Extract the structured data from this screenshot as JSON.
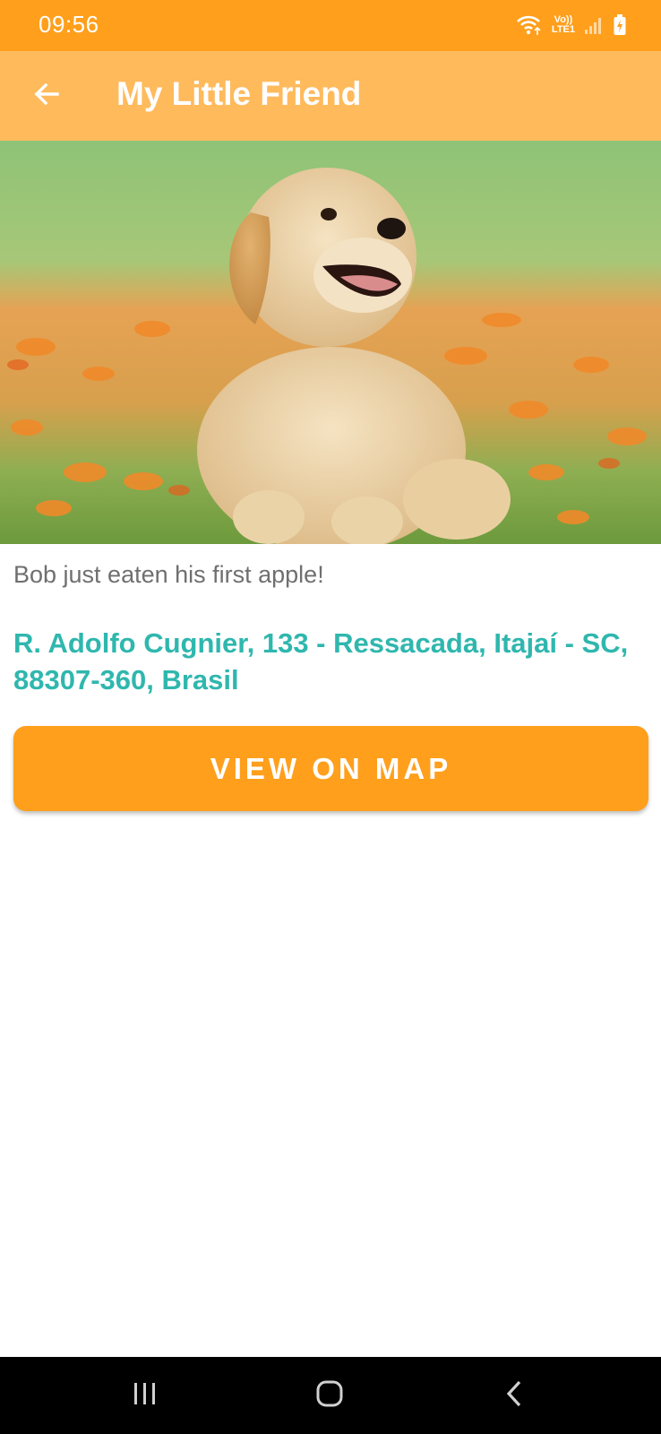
{
  "status_bar": {
    "time": "09:56",
    "network_top": "Vo))",
    "network_bottom": "LTE1",
    "icons": [
      "wifi-icon",
      "signal-icon",
      "battery-charging-icon"
    ]
  },
  "app_bar": {
    "title": "My Little Friend",
    "back_icon": "arrow-left-icon",
    "color": "#FFBA5C"
  },
  "post": {
    "photo": "golden-retriever-puppy-photo",
    "caption": "Bob just eaten his first apple!",
    "address": "R. Adolfo Cugnier, 133 - Ressacada, Itajaí - SC, 88307-360, Brasil"
  },
  "actions": {
    "view_map_label": "VIEW ON MAP"
  },
  "nav_bar": {
    "icons": [
      "recent-apps-icon",
      "home-icon",
      "back-icon"
    ]
  },
  "colors": {
    "primary": "#FF9F1C",
    "primary_light": "#FFBA5C",
    "accent": "#2FB7AE"
  }
}
